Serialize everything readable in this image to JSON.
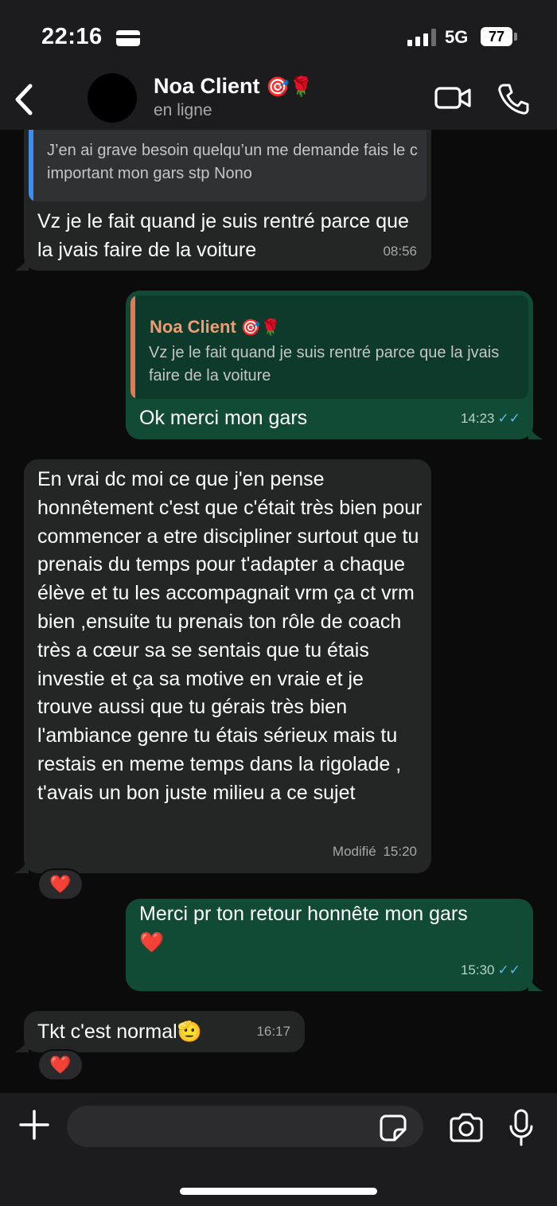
{
  "status_bar": {
    "time": "22:16",
    "network": "5G",
    "battery": "77",
    "signal_level": 3,
    "icons": [
      "card-icon",
      "signal-icon",
      "battery-icon"
    ]
  },
  "header": {
    "contact_name": "Noa Client",
    "contact_emoji": "🎯🌹",
    "status": "en ligne",
    "icons": [
      "back-icon",
      "video-call-icon",
      "phone-icon"
    ]
  },
  "messages": [
    {
      "id": "m1",
      "direction": "incoming",
      "quote_text": "J’en ai grave besoin quelqu’un me demande fais le c important mon gars stp Nono",
      "text": "Vz je le fait quand je suis rentré parce que la jvais faire de la voiture",
      "time": "08:56"
    },
    {
      "id": "m2",
      "direction": "outgoing",
      "quote_author": "Noa Client",
      "quote_author_emoji": "🎯🌹",
      "quote_text": "Vz je le fait quand je suis rentré parce que la jvais faire de la voiture",
      "text": "Ok merci mon gars",
      "time": "14:23",
      "read": true
    },
    {
      "id": "m3",
      "direction": "incoming",
      "text": "En vrai dc moi ce que j'en pense honnêtement c'est que c'était très bien pour commencer a etre discipliner surtout que tu prenais du temps pour t'adapter a chaque élève et tu les accompagnait vrm ça ct vrm bien ,ensuite tu prenais ton rôle de coach très a cœur sa se sentais que tu étais investie et ça sa motive en vraie et je trouve aussi que tu gérais très bien l'ambiance genre tu étais sérieux mais tu restais en meme temps dans la rigolade , t'avais un bon juste milieu a ce sujet",
      "edited_label": "Modifié",
      "time": "15:20",
      "reaction": "❤️"
    },
    {
      "id": "m4",
      "direction": "outgoing",
      "text": "Merci pr ton retour honnête mon gars",
      "emoji": "❤️",
      "time": "15:30",
      "read": true
    },
    {
      "id": "m5",
      "direction": "incoming",
      "text": "Tkt c'est normal",
      "emoji": "🫡",
      "time": "16:17",
      "reaction": "❤️"
    }
  ],
  "composer": {
    "placeholder": "",
    "icons": [
      "plus-icon",
      "sticker-icon",
      "camera-icon",
      "microphone-icon"
    ]
  },
  "colors": {
    "incoming_bubble": "#242626",
    "outgoing_bubble": "#114b36",
    "quote_bar_in": "#3d8ef0",
    "quote_bar_out": "#e07b5a",
    "quote_author": "#f29a70",
    "read_ticks": "#53bdeb",
    "background": "#0b0b0b"
  }
}
